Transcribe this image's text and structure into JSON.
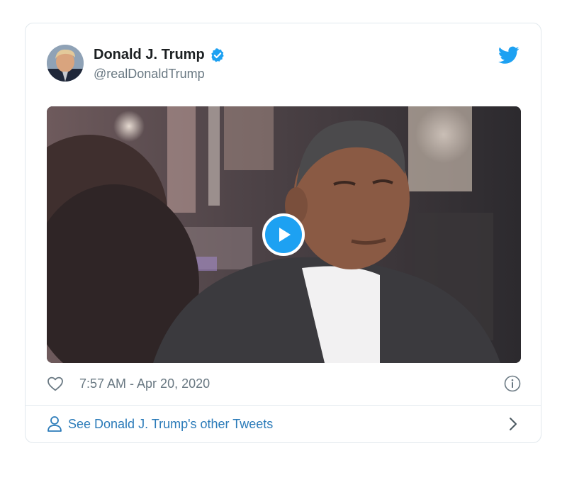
{
  "tweet": {
    "display_name": "Donald J. Trump",
    "handle": "@realDonaldTrump",
    "timestamp": "7:57 AM - Apr 20, 2020",
    "verified": true,
    "media_type": "video"
  },
  "footer": {
    "link_text": "See Donald J. Trump's other Tweets"
  },
  "icons": {
    "brand": "twitter-bird-icon",
    "verified": "verified-badge-icon",
    "play": "play-icon",
    "like": "heart-icon",
    "info": "info-icon",
    "profile": "person-icon",
    "chevron": "chevron-right-icon"
  },
  "colors": {
    "twitter_blue": "#1da1f2",
    "link_blue": "#2b7bb9",
    "secondary_text": "#697882",
    "border": "#e1e8ed"
  }
}
